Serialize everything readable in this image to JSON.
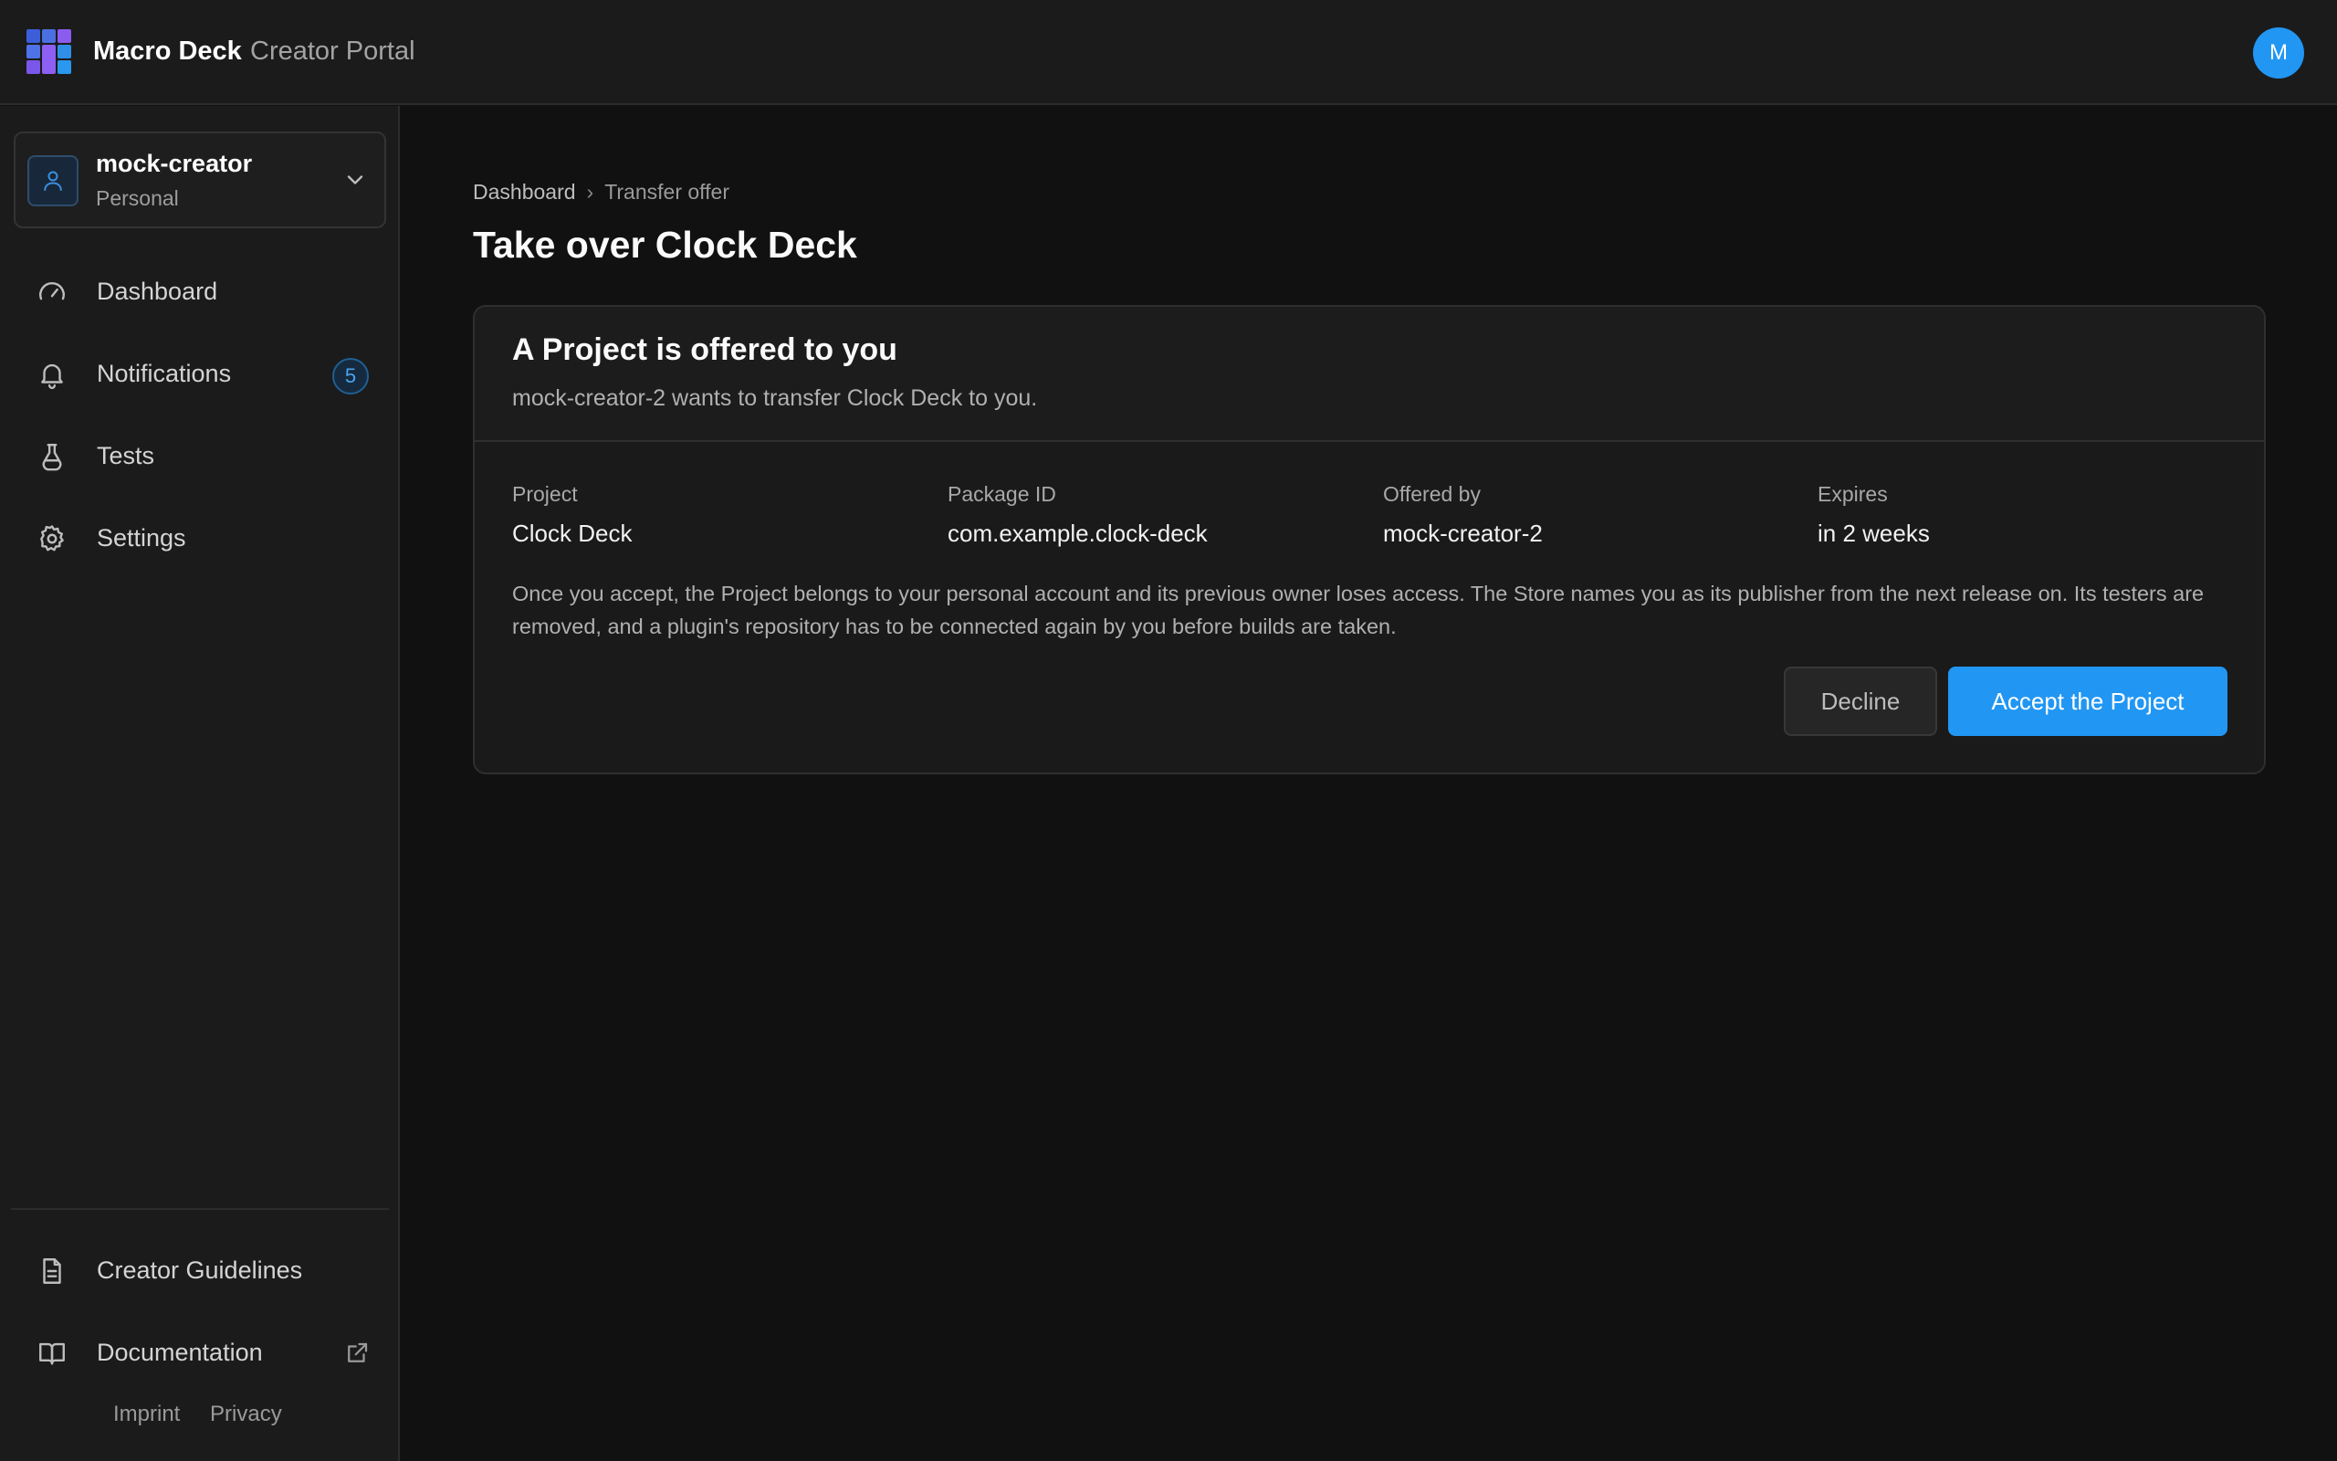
{
  "header": {
    "brand": "Macro Deck",
    "brand_sub": "Creator Portal",
    "avatar_initial": "M",
    "accent": "#2196f3"
  },
  "account": {
    "name": "mock-creator",
    "type": "Personal"
  },
  "sidebar": {
    "items": [
      {
        "label": "Dashboard",
        "icon": "gauge-icon"
      },
      {
        "label": "Notifications",
        "icon": "bell-icon",
        "badge": "5"
      },
      {
        "label": "Tests",
        "icon": "flask-icon"
      },
      {
        "label": "Settings",
        "icon": "gear-icon"
      }
    ],
    "bottom_items": [
      {
        "label": "Creator Guidelines",
        "icon": "document-icon"
      },
      {
        "label": "Documentation",
        "icon": "book-icon",
        "external": true
      }
    ],
    "footer_links": [
      "Imprint",
      "Privacy"
    ]
  },
  "breadcrumb": {
    "root": "Dashboard",
    "separator": "›",
    "current": "Transfer offer"
  },
  "page": {
    "title": "Take over Clock Deck"
  },
  "offer": {
    "title": "A Project is offered to you",
    "description": "mock-creator-2 wants to transfer Clock Deck to you.",
    "fields": [
      {
        "label": "Project",
        "value": "Clock Deck"
      },
      {
        "label": "Package ID",
        "value": "com.example.clock-deck"
      },
      {
        "label": "Offered by",
        "value": "mock-creator-2"
      },
      {
        "label": "Expires",
        "value": "in 2 weeks"
      }
    ],
    "notice": "Once you accept, the Project belongs to your personal account and its previous owner loses access. The Store names you as its publisher from the next release on. Its testers are removed, and a plugin's repository has to be connected again by you before builds are taken.",
    "decline_label": "Decline",
    "accept_label": "Accept the Project"
  }
}
